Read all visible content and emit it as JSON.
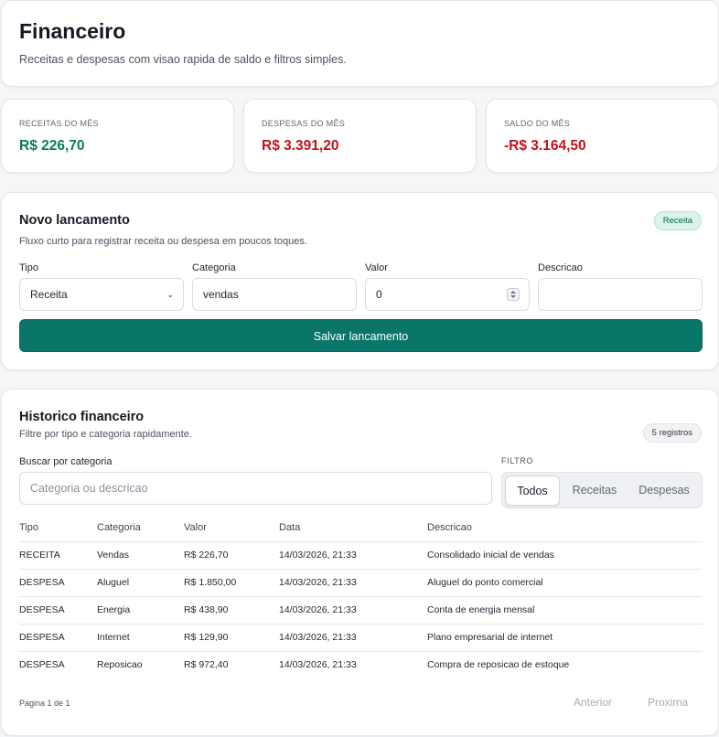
{
  "header": {
    "title": "Financeiro",
    "subtitle": "Receitas e despesas com visao rapida de saldo e filtros simples."
  },
  "stats": [
    {
      "label": "RECEITAS DO MÊS",
      "value": "R$ 226,70",
      "color": "#0a7a5c"
    },
    {
      "label": "DESPESAS DO MÊS",
      "value": "R$ 3.391,20",
      "color": "#c4121b"
    },
    {
      "label": "SALDO DO MÊS",
      "value": "-R$ 3.164,50",
      "color": "#c4121b"
    }
  ],
  "entry": {
    "title": "Novo lancamento",
    "subtitle": "Fluxo curto para registrar receita ou despesa em poucos toques.",
    "badge": "Receita",
    "fields": {
      "tipo_label": "Tipo",
      "tipo_value": "Receita",
      "categoria_label": "Categoria",
      "categoria_value": "vendas",
      "valor_label": "Valor",
      "valor_value": "0",
      "descricao_label": "Descricao",
      "descricao_value": ""
    },
    "save_label": "Salvar lancamento"
  },
  "history": {
    "title": "Historico financeiro",
    "subtitle": "Filtre por tipo e categoria rapidamente.",
    "count_badge": "5 registros",
    "search_label": "Buscar por categoria",
    "search_placeholder": "Categoria ou descricao",
    "filter_label": "FILTRO",
    "filters": [
      "Todos",
      "Receitas",
      "Despesas"
    ],
    "active_filter": "Todos",
    "columns": [
      "Tipo",
      "Categoria",
      "Valor",
      "Data",
      "Descricao"
    ],
    "rows": [
      [
        "RECEITA",
        "Vendas",
        "R$ 226,70",
        "14/03/2026, 21:33",
        "Consolidado inicial de vendas"
      ],
      [
        "DESPESA",
        "Aluguel",
        "R$ 1.850,00",
        "14/03/2026, 21:33",
        "Aluguel do ponto comercial"
      ],
      [
        "DESPESA",
        "Energia",
        "R$ 438,90",
        "14/03/2026, 21:33",
        "Conta de energia mensal"
      ],
      [
        "DESPESA",
        "Internet",
        "R$ 129,90",
        "14/03/2026, 21:33",
        "Plano empresarial de internet"
      ],
      [
        "DESPESA",
        "Reposicao",
        "R$ 972,40",
        "14/03/2026, 21:33",
        "Compra de reposicao de estoque"
      ]
    ],
    "page_info": "Pagina 1 de 1",
    "prev_label": "Anterior",
    "next_label": "Proxima"
  }
}
